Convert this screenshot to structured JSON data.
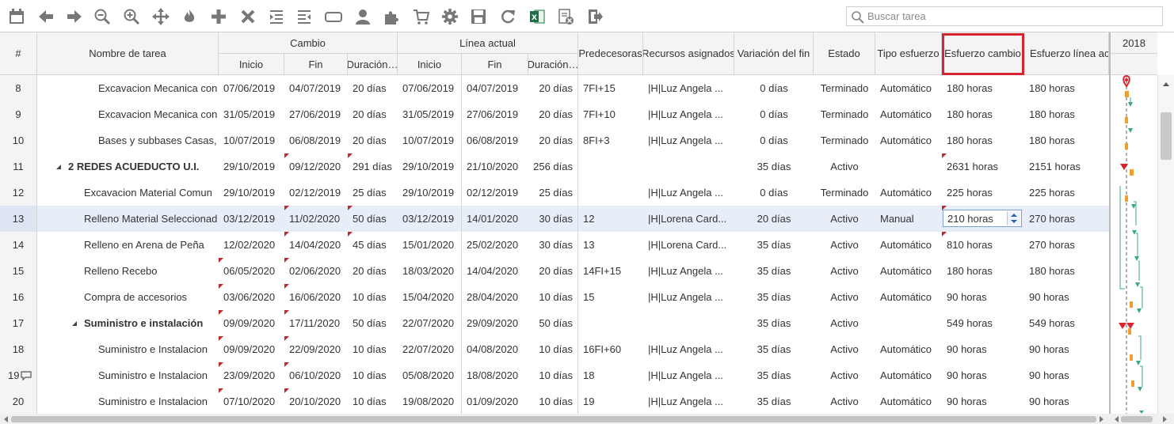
{
  "toolbar": {
    "icons": [
      "calendar-icon",
      "arrow-left-icon",
      "arrow-right-icon",
      "zoom-out-icon",
      "zoom-in-icon",
      "move-icon",
      "critical-path-fire-icon",
      "add-icon",
      "delete-icon",
      "indent-icon",
      "outdent-icon",
      "link-icon",
      "resources-user-icon",
      "puzzle-icon",
      "cart-icon",
      "settings-gear-icon",
      "save-icon",
      "refresh-icon",
      "excel-icon",
      "clear-sheet-icon",
      "export-icon"
    ]
  },
  "search": {
    "placeholder": "Buscar tarea"
  },
  "header": {
    "num": "#",
    "name": "Nombre de tarea",
    "cambio": "Cambio",
    "linea_actual": "Línea actual",
    "inicio": "Inicio",
    "fin": "Fin",
    "duracion": "Duración…",
    "inicio2": "Inicio",
    "fin2": "Fin",
    "duracion2": "Duración…",
    "predecesoras": "Predecesoras",
    "recursos": "Recursos asignados",
    "variacion": "Variación del fin",
    "estado": "Estado",
    "tipo": "Tipo esfuerzo",
    "esfuerzo_cambio": "Esfuerzo cambio",
    "esfuerzo_linea": "Esfuerzo línea act"
  },
  "gantt": {
    "year": "2018"
  },
  "rows": [
    {
      "num": "8",
      "name": "Excavacion Mecanica con",
      "indent": 2,
      "ini": "07/06/2019",
      "fin": "04/07/2019",
      "dur": "20 días",
      "ini2": "07/06/2019",
      "fin2": "04/07/2019",
      "dur2": "20 días",
      "pred": "7FI+15",
      "rec": "|H|Luz Angela ...",
      "var": "0 días",
      "estado": "Terminado",
      "tipo": "Automático",
      "esf": "180 horas",
      "esf2": "180 horas"
    },
    {
      "num": "9",
      "name": "Excavacion Mecanica con",
      "indent": 2,
      "ini": "31/05/2019",
      "fin": "27/06/2019",
      "dur": "20 días",
      "ini2": "31/05/2019",
      "fin2": "27/06/2019",
      "dur2": "20 días",
      "pred": "7FI+10",
      "rec": "|H|Luz Angela ...",
      "var": "0 días",
      "estado": "Terminado",
      "tipo": "Automático",
      "esf": "180 horas",
      "esf2": "180 horas"
    },
    {
      "num": "10",
      "name": "Bases y subbases Casas,",
      "indent": 2,
      "ini": "10/07/2019",
      "fin": "06/08/2019",
      "dur": "20 días",
      "ini2": "10/07/2019",
      "fin2": "06/08/2019",
      "dur2": "20 días",
      "pred": "8FI+3",
      "rec": "|H|Luz Angela ...",
      "var": "0 días",
      "estado": "Terminado",
      "tipo": "Automático",
      "esf": "180 horas",
      "esf2": "180 horas"
    },
    {
      "num": "11",
      "name": "2 REDES ACUEDUCTO U.I.",
      "indent": 0,
      "group": true,
      "ini": "29/10/2019",
      "fin": "09/12/2020",
      "dur": "291 días",
      "ini2": "29/10/2019",
      "fin2": "21/10/2020",
      "dur2": "256 días",
      "pred": "",
      "rec": "",
      "var": "35 días",
      "estado": "Activo",
      "tipo": "",
      "esf": "2631 horas",
      "esf2": "2151 horas",
      "fFin": true,
      "fDur": true,
      "fEsf": true
    },
    {
      "num": "12",
      "name": "Excavacion Material Comun",
      "indent": 1,
      "ini": "29/10/2019",
      "fin": "02/12/2019",
      "dur": "25 días",
      "ini2": "29/10/2019",
      "fin2": "02/12/2019",
      "dur2": "25 días",
      "pred": "",
      "rec": "|H|Luz Angela ...",
      "var": "0 días",
      "estado": "Terminado",
      "tipo": "Automático",
      "esf": "225 horas",
      "esf2": "225 horas"
    },
    {
      "num": "13",
      "name": "Relleno Material Seleccionad",
      "indent": 1,
      "ini": "03/12/2019",
      "fin": "11/02/2020",
      "dur": "50 días",
      "ini2": "03/12/2019",
      "fin2": "14/01/2020",
      "dur2": "30 días",
      "pred": "12",
      "rec": "|H|Lorena Card...",
      "var": "20 días",
      "estado": "Activo",
      "tipo": "Manual",
      "esf": "210 horas",
      "esf2": "270 horas",
      "sel": true,
      "fFin": true,
      "fDur": true,
      "fEsf": true
    },
    {
      "num": "14",
      "name": "Relleno en Arena de Peña",
      "indent": 1,
      "ini": "12/02/2020",
      "fin": "14/04/2020",
      "dur": "45 días",
      "ini2": "15/01/2020",
      "fin2": "25/02/2020",
      "dur2": "30 días",
      "pred": "13",
      "rec": "|H|Lorena Card...",
      "var": "35 días",
      "estado": "Activo",
      "tipo": "Automático",
      "esf": "810 horas",
      "esf2": "270 horas",
      "fFin": true,
      "fDur": true,
      "fEsf": true
    },
    {
      "num": "15",
      "name": "Relleno Recebo",
      "indent": 1,
      "ini": "06/05/2020",
      "fin": "02/06/2020",
      "dur": "20 días",
      "ini2": "18/03/2020",
      "fin2": "14/04/2020",
      "dur2": "20 días",
      "pred": "14FI+15",
      "rec": "|H|Luz Angela ...",
      "var": "35 días",
      "estado": "Activo",
      "tipo": "Automático",
      "esf": "180 horas",
      "esf2": "180 horas",
      "fIni": true,
      "fFin": true
    },
    {
      "num": "16",
      "name": "Compra de accesorios",
      "indent": 1,
      "ini": "03/06/2020",
      "fin": "16/06/2020",
      "dur": "10 días",
      "ini2": "15/04/2020",
      "fin2": "28/04/2020",
      "dur2": "10 días",
      "pred": "15",
      "rec": "|H|Luz Angela ...",
      "var": "35 días",
      "estado": "Activo",
      "tipo": "Automático",
      "esf": "90 horas",
      "esf2": "90 horas",
      "fIni": true,
      "fFin": true
    },
    {
      "num": "17",
      "name": "Suministro e instalación",
      "indent": 1,
      "group": true,
      "ini": "09/09/2020",
      "fin": "17/11/2020",
      "dur": "50 días",
      "ini2": "22/07/2020",
      "fin2": "29/09/2020",
      "dur2": "50 días",
      "pred": "",
      "rec": "",
      "var": "35 días",
      "estado": "Activo",
      "tipo": "",
      "esf": "549 horas",
      "esf2": "549 horas",
      "fIni": true,
      "fFin": true
    },
    {
      "num": "18",
      "name": "Suministro e Instalacion",
      "indent": 2,
      "ini": "09/09/2020",
      "fin": "22/09/2020",
      "dur": "10 días",
      "ini2": "22/07/2020",
      "fin2": "04/08/2020",
      "dur2": "10 días",
      "pred": "16FI+60",
      "rec": "|H|Luz Angela ...",
      "var": "35 días",
      "estado": "Activo",
      "tipo": "Automático",
      "esf": "90 horas",
      "esf2": "90 horas",
      "fIni": true,
      "fFin": true
    },
    {
      "num": "19",
      "name": "Suministro e Instalacion",
      "indent": 2,
      "comment": true,
      "ini": "23/09/2020",
      "fin": "06/10/2020",
      "dur": "10 días",
      "ini2": "05/08/2020",
      "fin2": "18/08/2020",
      "dur2": "10 días",
      "pred": "18",
      "rec": "|H|Luz Angela ...",
      "var": "35 días",
      "estado": "Activo",
      "tipo": "Automático",
      "esf": "90 horas",
      "esf2": "90 horas",
      "fIni": true,
      "fFin": true
    },
    {
      "num": "20",
      "name": "Suministro e Instalacion",
      "indent": 2,
      "ini": "07/10/2020",
      "fin": "20/10/2020",
      "dur": "10 días",
      "ini2": "19/08/2020",
      "fin2": "01/09/2020",
      "dur2": "10 días",
      "pred": "19",
      "rec": "|H|Luz Angela ...",
      "var": "35 días",
      "estado": "Activo",
      "tipo": "Automático",
      "esf": "90 horas",
      "esf2": "90 horas",
      "fIni": true,
      "fFin": true
    }
  ]
}
